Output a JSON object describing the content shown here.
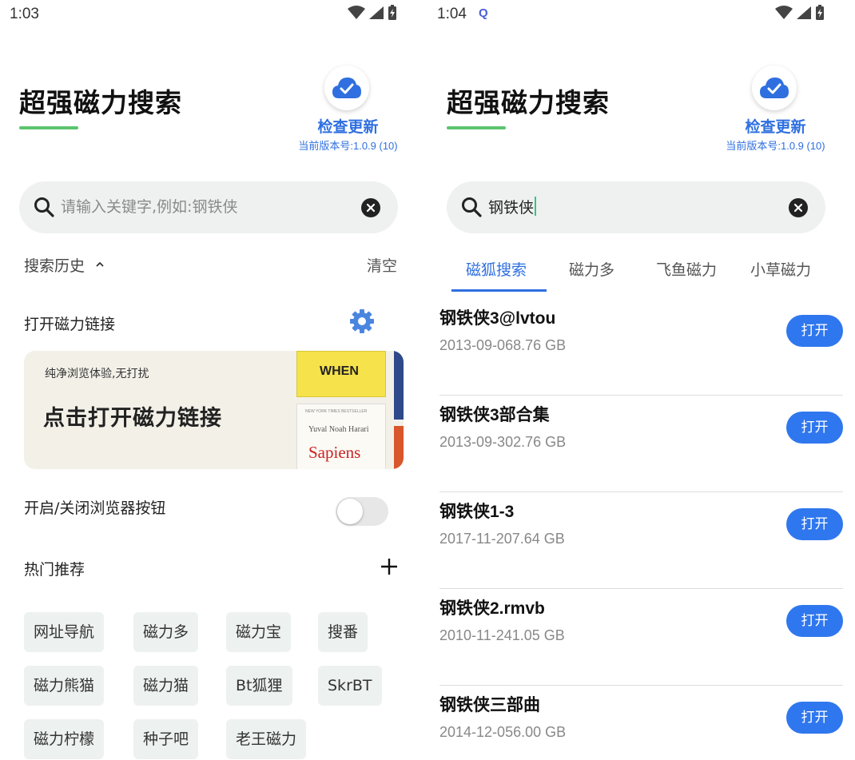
{
  "left": {
    "status": {
      "time": "1:03"
    },
    "app_title": "超强磁力搜索",
    "update": {
      "label": "检查更新",
      "version": "当前版本号:1.0.9 (10)"
    },
    "search": {
      "placeholder": "请输入关键字,例如:钢铁侠",
      "value": ""
    },
    "history": {
      "label": "搜索历史",
      "clear": "清空"
    },
    "magnet": {
      "label": "打开磁力链接"
    },
    "banner": {
      "subtitle": "纯净浏览体验,无打扰",
      "title": "点击打开磁力链接",
      "book1_title": "WHEN",
      "book2_author": "Yuval Noah Harari",
      "book2_title": "Sapiens",
      "book2_tag": "NEW YORK TIMES BESTSELLER"
    },
    "browser_toggle": {
      "label": "开启/关闭浏览器按钮",
      "state": "off"
    },
    "hot": {
      "label": "热门推荐",
      "chips": [
        "网址导航",
        "磁力多",
        "磁力宝",
        "搜番",
        "磁力熊猫",
        "磁力猫",
        "Bt狐狸",
        "SkrBT",
        "磁力柠檬",
        "种子吧",
        "老王磁力"
      ]
    }
  },
  "right": {
    "status": {
      "time": "1:04"
    },
    "app_title": "超强磁力搜索",
    "update": {
      "label": "检查更新",
      "version": "当前版本号:1.0.9 (10)"
    },
    "search": {
      "value": "钢铁侠"
    },
    "tabs": [
      "磁狐搜索",
      "磁力多",
      "飞鱼磁力",
      "小草磁力"
    ],
    "active_tab": "磁狐搜索",
    "results": [
      {
        "name": "钢铁侠3@lvtou",
        "meta": "2013-09-068.76 GB",
        "action": "打开"
      },
      {
        "name": "钢铁侠3部合集",
        "meta": "2013-09-302.76 GB",
        "action": "打开"
      },
      {
        "name": "钢铁侠1-3",
        "meta": "2017-11-207.64 GB",
        "action": "打开"
      },
      {
        "name": "钢铁侠2.rmvb",
        "meta": "2010-11-241.05 GB",
        "action": "打开"
      },
      {
        "name": "钢铁侠三部曲",
        "meta": "2014-12-056.00 GB",
        "action": "打开"
      }
    ]
  },
  "colors": {
    "accent": "#2f6fe0",
    "underline": "#5cc46e",
    "button": "#2f77ee",
    "chip_bg": "#edf1f0",
    "search_bg": "#eef1f0"
  }
}
